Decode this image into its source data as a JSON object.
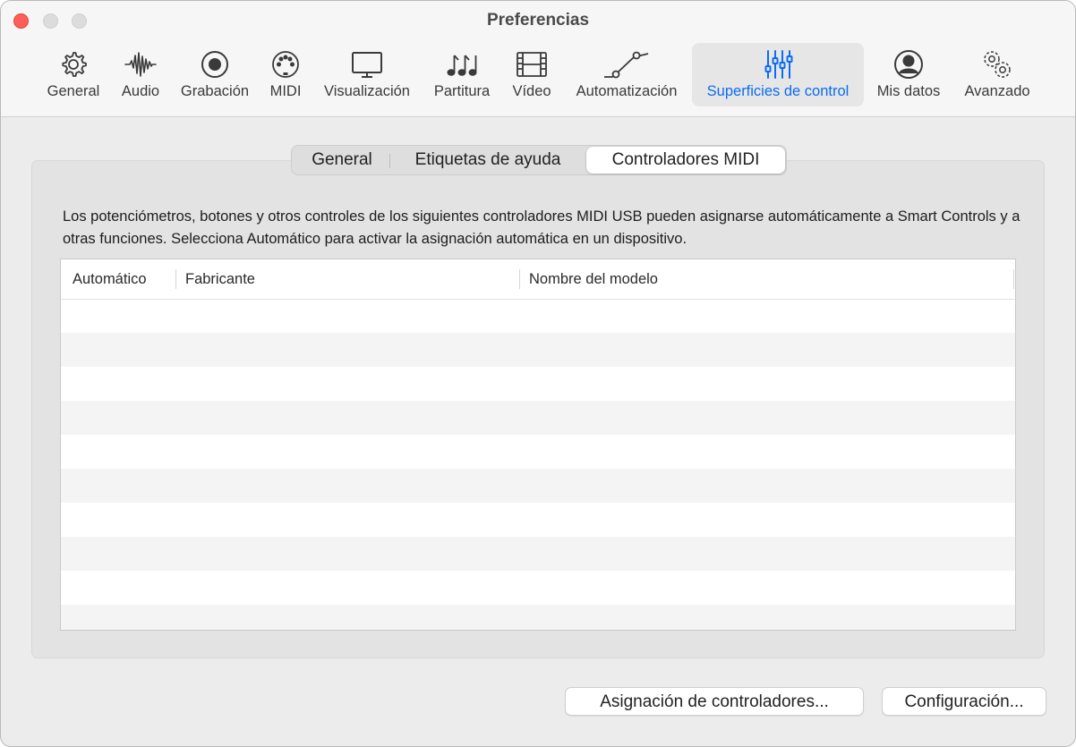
{
  "window": {
    "title": "Preferencias"
  },
  "toolbar": {
    "items": [
      {
        "label": "General",
        "icon": "gear-icon"
      },
      {
        "label": "Audio",
        "icon": "waveform-icon"
      },
      {
        "label": "Grabación",
        "icon": "record-icon"
      },
      {
        "label": "MIDI",
        "icon": "midi-port-icon"
      },
      {
        "label": "Visualización",
        "icon": "display-icon"
      },
      {
        "label": "Partitura",
        "icon": "music-notes-icon"
      },
      {
        "label": "Vídeo",
        "icon": "film-icon"
      },
      {
        "label": "Automatización",
        "icon": "automation-curve-icon"
      },
      {
        "label": "Superficies de control",
        "icon": "sliders-icon"
      },
      {
        "label": "Mis datos",
        "icon": "person-circle-icon"
      },
      {
        "label": "Avanzado",
        "icon": "gears-icon"
      }
    ],
    "selected": "Superficies de control",
    "accent_color": "#0a6cf5"
  },
  "tabs": {
    "items": [
      "General",
      "Etiquetas de ayuda",
      "Controladores MIDI"
    ],
    "active": "Controladores MIDI"
  },
  "main": {
    "description": "Los potenciómetros, botones y otros controles de los siguientes controladores MIDI USB pueden asignarse automáticamente a Smart Controls y a otras funciones. Selecciona Automático para activar la asignación automática en un dispositivo.",
    "table": {
      "columns": [
        "Automático",
        "Fabricante",
        "Nombre del modelo"
      ],
      "rows": []
    }
  },
  "buttons": {
    "controller_assignments": "Asignación de controladores...",
    "setup": "Configuración..."
  }
}
